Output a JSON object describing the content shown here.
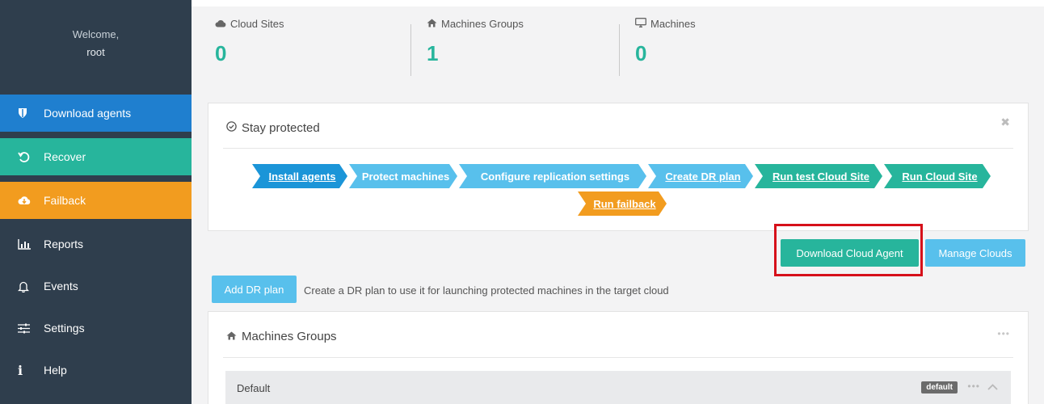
{
  "sidebar": {
    "welcome": "Welcome,",
    "user": "root",
    "items": [
      {
        "label": "Download agents",
        "icon": "shield-icon",
        "color": "#1f7fcf"
      },
      {
        "label": "Recover",
        "icon": "undo-icon",
        "color": "#27b59c"
      },
      {
        "label": "Failback",
        "icon": "cloud-download-icon",
        "color": "#f29c1f"
      },
      {
        "label": "Reports",
        "icon": "bar-chart-icon"
      },
      {
        "label": "Events",
        "icon": "bell-icon"
      },
      {
        "label": "Settings",
        "icon": "sliders-icon"
      },
      {
        "label": "Help",
        "icon": "info-icon"
      }
    ]
  },
  "stats": [
    {
      "label": "Cloud Sites",
      "value": "0",
      "icon": "cloud-icon"
    },
    {
      "label": "Machines Groups",
      "value": "1",
      "icon": "home-icon"
    },
    {
      "label": "Machines",
      "value": "0",
      "icon": "monitor-icon"
    }
  ],
  "stay_protected": {
    "title": "Stay protected",
    "steps": [
      {
        "label": "Install agents",
        "color": "#1b95d8"
      },
      {
        "label": "Protect machines",
        "color": "#58c0ec"
      },
      {
        "label": "Configure replication settings",
        "color": "#58c0ec"
      },
      {
        "label": "Create DR plan",
        "color": "#58c0ec"
      },
      {
        "label": "Run test Cloud Site",
        "color": "#27b59c"
      },
      {
        "label": "Run Cloud Site",
        "color": "#27b59c"
      },
      {
        "label": "Run failback",
        "color": "#f29c1f"
      }
    ]
  },
  "actions": {
    "download_cloud_agent": "Download Cloud Agent",
    "manage_clouds": "Manage Clouds",
    "add_dr_plan": "Add DR plan",
    "add_dr_plan_hint": "Create a DR plan to use it for launching protected machines in the target cloud"
  },
  "machines_groups": {
    "title": "Machines Groups",
    "rows": [
      {
        "name": "Default",
        "badge": "default"
      }
    ]
  }
}
